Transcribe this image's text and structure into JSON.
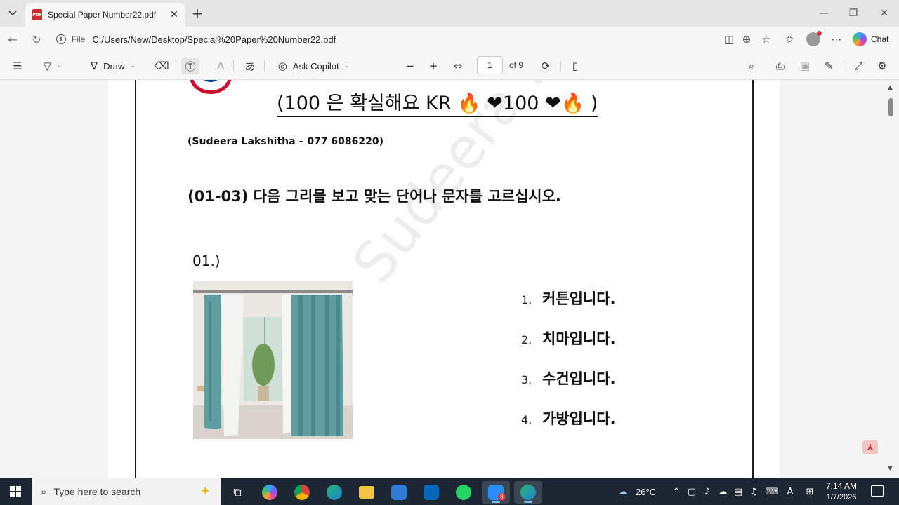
{
  "browser": {
    "tab_title": "Special Paper Number22.pdf",
    "tab_icon_text": "PDF",
    "url_scheme": "File",
    "url": "C:/Users/New/Desktop/Special%20Paper%20Number22.pdf",
    "chat_label": "Chat"
  },
  "pdf_toolbar": {
    "draw_label": "Draw",
    "copilot_label": "Ask Copilot",
    "page_current": "1",
    "page_of": "of 9"
  },
  "document": {
    "headline": "(100 은 확실해요 KR 🔥 ❤100 ❤🔥 )",
    "author": "(Sudeera Lakshitha – 077 6086220)",
    "instruction": "(01-03) 다음 그리믈 보고 맞는 단어나 문자를 고르십시오.",
    "question_number": "01.)",
    "watermark": "Sudeera Lakshitha",
    "choices": [
      {
        "num": "1.",
        "text": "커튼입니다."
      },
      {
        "num": "2.",
        "text": "치마입니다."
      },
      {
        "num": "3.",
        "text": "수건입니다."
      },
      {
        "num": "4.",
        "text": "가방입니다."
      }
    ]
  },
  "taskbar": {
    "search_placeholder": "Type here to search",
    "weather": "26°C",
    "time": "7:14 AM",
    "date": "1/7/2026",
    "zoom_badge": "8"
  },
  "colors": {
    "curtain_teal": "#5f9ea0",
    "taskbar_bg": "#1c2733",
    "pdf_red": "#c8312b"
  }
}
